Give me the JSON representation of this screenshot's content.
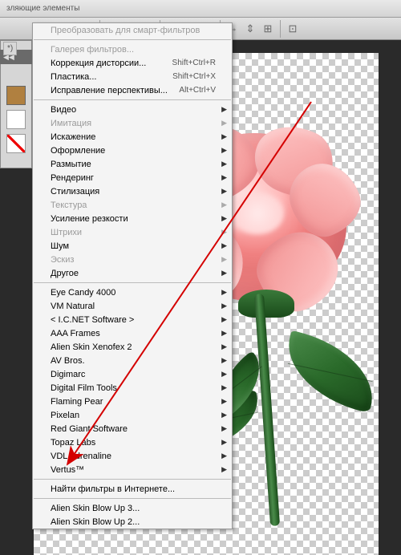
{
  "menubar_fragment": "зляющие элементы",
  "tab_close": "✕",
  "tab_star": "*)",
  "menu": {
    "sections": [
      {
        "items": [
          {
            "label": "Преобразовать для смарт-фильтров",
            "disabled": true
          }
        ]
      },
      {
        "items": [
          {
            "label": "Галерея фильтров...",
            "disabled": true
          },
          {
            "label": "Коррекция дисторсии...",
            "shortcut": "Shift+Ctrl+R"
          },
          {
            "label": "Пластика...",
            "shortcut": "Shift+Ctrl+X"
          },
          {
            "label": "Исправление перспективы...",
            "shortcut": "Alt+Ctrl+V"
          }
        ]
      },
      {
        "items": [
          {
            "label": "Видео",
            "submenu": true
          },
          {
            "label": "Имитация",
            "submenu": true,
            "disabled": true
          },
          {
            "label": "Искажение",
            "submenu": true
          },
          {
            "label": "Оформление",
            "submenu": true
          },
          {
            "label": "Размытие",
            "submenu": true
          },
          {
            "label": "Рендеринг",
            "submenu": true
          },
          {
            "label": "Стилизация",
            "submenu": true
          },
          {
            "label": "Текстура",
            "submenu": true,
            "disabled": true
          },
          {
            "label": "Усиление резкости",
            "submenu": true
          },
          {
            "label": "Штрихи",
            "submenu": true,
            "disabled": true
          },
          {
            "label": "Шум",
            "submenu": true
          },
          {
            "label": "Эскиз",
            "submenu": true,
            "disabled": true
          },
          {
            "label": "Другое",
            "submenu": true
          }
        ]
      },
      {
        "items": [
          {
            "label": " Eye Candy 4000",
            "submenu": true
          },
          {
            "label": " VM Natural",
            "submenu": true
          },
          {
            "label": "< I.C.NET Software >",
            "submenu": true
          },
          {
            "label": "AAA Frames",
            "submenu": true
          },
          {
            "label": "Alien Skin Xenofex 2",
            "submenu": true
          },
          {
            "label": "AV Bros.",
            "submenu": true
          },
          {
            "label": "Digimarc",
            "submenu": true
          },
          {
            "label": "Digital Film Tools",
            "submenu": true
          },
          {
            "label": "Flaming Pear",
            "submenu": true
          },
          {
            "label": "Pixelan",
            "submenu": true
          },
          {
            "label": "Red Giant Software",
            "submenu": true
          },
          {
            "label": "Topaz Labs",
            "submenu": true
          },
          {
            "label": "VDL Adrenaline",
            "submenu": true
          },
          {
            "label": "Vertus™",
            "submenu": true
          }
        ]
      },
      {
        "items": [
          {
            "label": "Найти фильтры в Интернете..."
          }
        ]
      },
      {
        "items": [
          {
            "label": "Alien Skin Blow Up 3..."
          },
          {
            "label": "Alien Skin Blow Up 2..."
          }
        ]
      }
    ]
  }
}
